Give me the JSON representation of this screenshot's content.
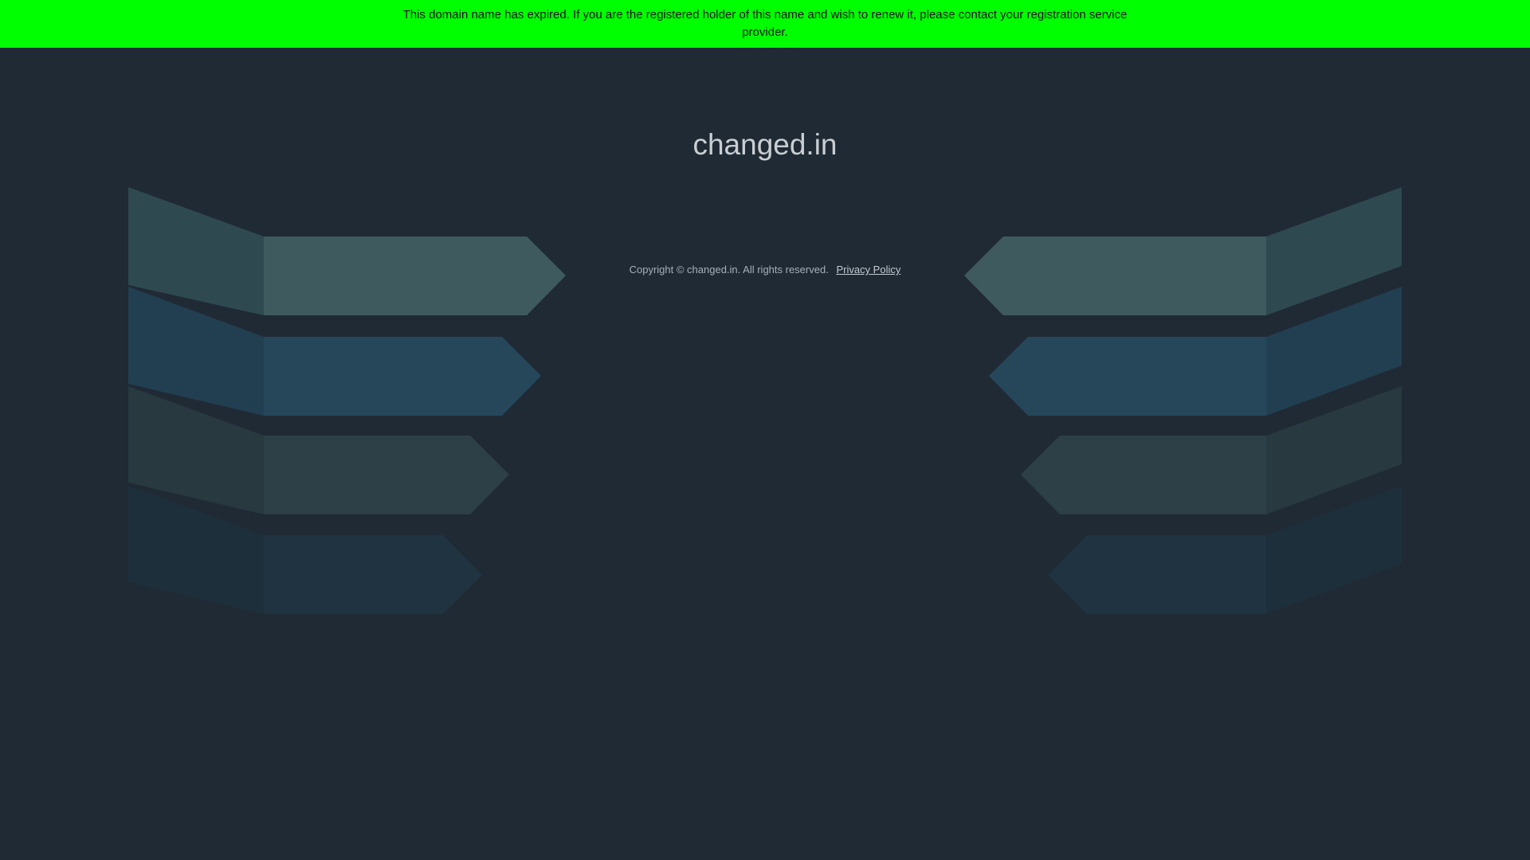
{
  "banner": {
    "message": "This domain name has expired. If you are the registered holder of this name and wish to renew it, please contact your registration service provider."
  },
  "page": {
    "domain_title": "changed.in"
  },
  "footer": {
    "copyright": "Copyright © changed.in.  All rights reserved.",
    "privacy_label": "Privacy Policy"
  },
  "colors": {
    "banner_background": "#00ff00",
    "page_background": "#1f2a35",
    "band_gray": "#3f5a5e",
    "band_blue": "#26475a",
    "band_dark": "#2d3f47",
    "band_navy": "#1f3341"
  }
}
